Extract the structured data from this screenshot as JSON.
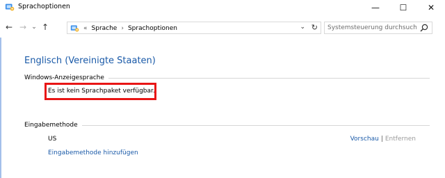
{
  "window": {
    "title": "Sprachoptionen",
    "icon": "control-panel-icon",
    "buttons": {
      "minimize": "—",
      "maximize": "☐",
      "close": "✕"
    }
  },
  "nav": {
    "back": "←",
    "forward": "→",
    "recent": "⌄",
    "up": "↑",
    "chevron": "«",
    "breadcrumb": [
      "Sprache",
      "Sprachoptionen"
    ],
    "separator": "›",
    "dropdown": "⌄",
    "refresh": "↻"
  },
  "search": {
    "placeholder": "Systemsteuerung durchsuchen",
    "value": ""
  },
  "content": {
    "language_title": "Englisch (Vereinigte Staaten)",
    "display_language_section": "Windows-Anzeigesprache",
    "display_language_status": "Es ist kein Sprachpaket verfügbar.",
    "input_method_section": "Eingabemethode",
    "input_method_name": "US",
    "preview_link": "Vorschau",
    "action_separator": "|",
    "remove_link": "Entfernen",
    "add_method_link": "Eingabemethode hinzufügen"
  },
  "colors": {
    "link": "#1a5aa8",
    "highlight": "#e81515",
    "disabled": "#9a9a9a"
  }
}
